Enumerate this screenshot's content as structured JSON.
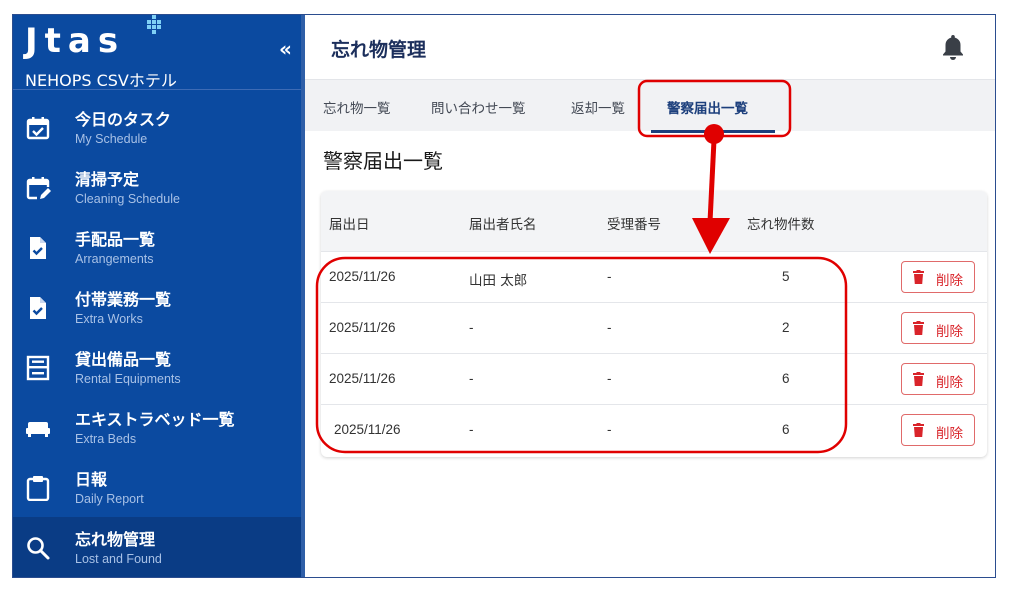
{
  "app": {
    "logo": "Jtas",
    "hotel_name": "NEHOPS CSVホテル",
    "collapse_glyph": "«"
  },
  "sidebar": {
    "items": [
      {
        "title": "今日のタスク",
        "subtitle": "My Schedule",
        "icon": "calendar-check-icon"
      },
      {
        "title": "清掃予定",
        "subtitle": "Cleaning Schedule",
        "icon": "calendar-edit-icon"
      },
      {
        "title": "手配品一覧",
        "subtitle": "Arrangements",
        "icon": "document-check-icon"
      },
      {
        "title": "付帯業務一覧",
        "subtitle": "Extra Works",
        "icon": "document-check-icon"
      },
      {
        "title": "貸出備品一覧",
        "subtitle": "Rental Equipments",
        "icon": "cabinet-icon"
      },
      {
        "title": "エキストラベッド一覧",
        "subtitle": "Extra Beds",
        "icon": "bed-icon"
      },
      {
        "title": "日報",
        "subtitle": "Daily Report",
        "icon": "clipboard-icon"
      },
      {
        "title": "忘れ物管理",
        "subtitle": "Lost and Found",
        "icon": "search-icon",
        "active": true
      }
    ]
  },
  "header": {
    "title": "忘れ物管理",
    "icon": "bell-icon"
  },
  "tabs": [
    {
      "label": "忘れ物一覧"
    },
    {
      "label": "問い合わせ一覧"
    },
    {
      "label": "返却一覧"
    },
    {
      "label": "警察届出一覧",
      "active": true
    }
  ],
  "section_title": "警察届出一覧",
  "table": {
    "columns": [
      "届出日",
      "届出者氏名",
      "受理番号",
      "忘れ物件数"
    ],
    "rows": [
      {
        "date": "2025/11/26",
        "reporter": "山田 太郎",
        "receipt_no": "-",
        "count": "5"
      },
      {
        "date": "2025/11/26",
        "reporter": "-",
        "receipt_no": "-",
        "count": "2"
      },
      {
        "date": "2025/11/26",
        "reporter": "-",
        "receipt_no": "-",
        "count": "6"
      },
      {
        "date": "2025/11/26",
        "reporter": "-",
        "receipt_no": "-",
        "count": "6"
      }
    ],
    "delete_label": "削除"
  },
  "colors": {
    "sidebar_bg": "#0b4aa0",
    "sidebar_active": "#0a3c85",
    "accent": "#1c3f7c",
    "delete": "#d9242a",
    "annotation": "#e00000"
  }
}
